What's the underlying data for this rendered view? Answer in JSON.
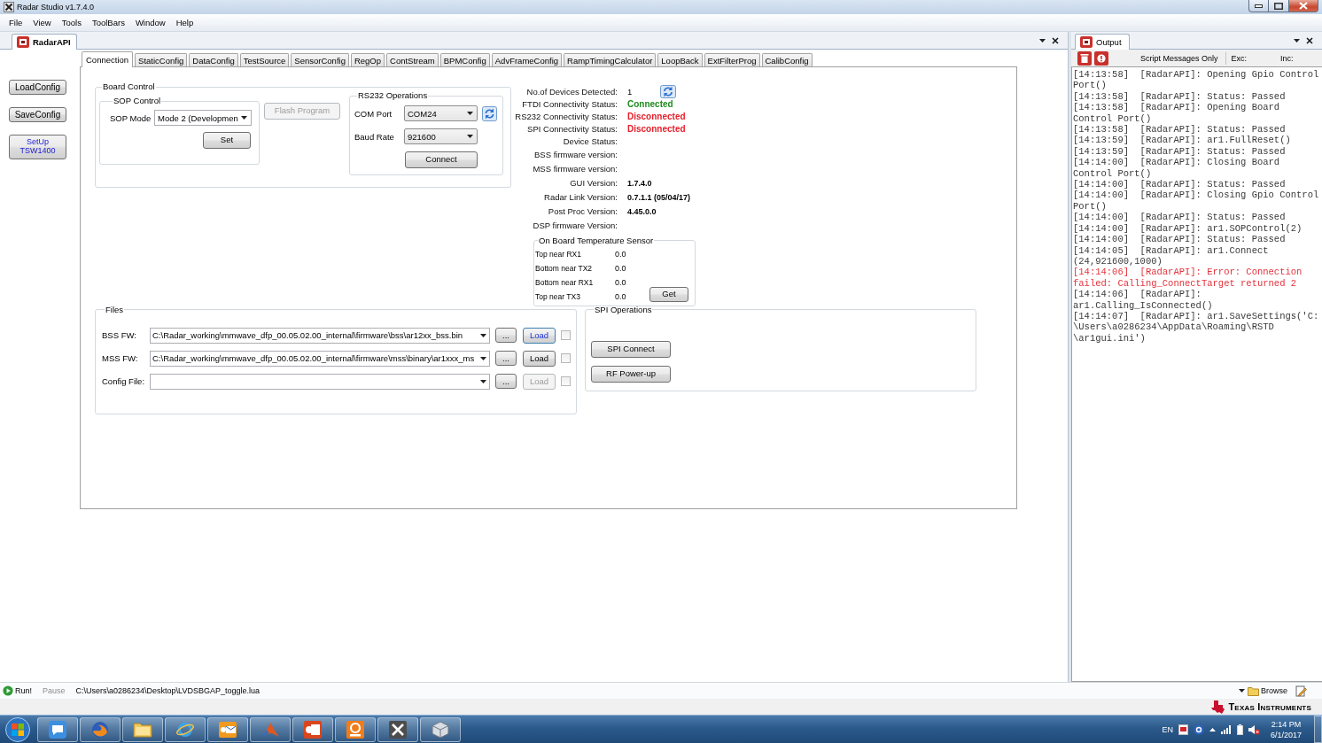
{
  "window": {
    "title": "Radar Studio v1.7.4.0"
  },
  "menu": [
    "File",
    "View",
    "Tools",
    "ToolBars",
    "Window",
    "Help"
  ],
  "document": {
    "tab": "RadarAPI",
    "side_buttons": [
      {
        "lines": [
          "LoadConfig"
        ],
        "kind": "plain"
      },
      {
        "lines": [
          "SaveConfig"
        ],
        "kind": "plain"
      },
      {
        "lines": [
          "SetUp",
          "TSW1400"
        ],
        "kind": "link"
      }
    ],
    "tabs": [
      {
        "label": "Connection",
        "selected": true
      },
      {
        "label": "StaticConfig",
        "selected": false
      },
      {
        "label": "DataConfig",
        "selected": false
      },
      {
        "label": "TestSource",
        "selected": false
      },
      {
        "label": "SensorConfig",
        "selected": false
      },
      {
        "label": "RegOp",
        "selected": false
      },
      {
        "label": "ContStream",
        "selected": false
      },
      {
        "label": "BPMConfig",
        "selected": false
      },
      {
        "label": "AdvFrameConfig",
        "selected": false
      },
      {
        "label": "RampTimingCalculator",
        "selected": false
      },
      {
        "label": "LoopBack",
        "selected": false
      },
      {
        "label": "ExtFilterProg",
        "selected": false
      },
      {
        "label": "CalibConfig",
        "selected": false
      }
    ],
    "board_control": {
      "title": "Board Control",
      "sop_control": {
        "title": "SOP Control",
        "label": "SOP Mode",
        "value": "Mode 2 (Developmen",
        "button": "Set"
      },
      "flash_button": {
        "label": "Flash Program",
        "disabled": true
      },
      "rs232": {
        "title": "RS232 Operations",
        "fields": [
          {
            "label": "COM Port",
            "value": "COM24",
            "refresh": true
          },
          {
            "label": "Baud Rate",
            "value": "921600",
            "refresh": false
          }
        ],
        "button": "Connect"
      }
    },
    "status": [
      {
        "label": "No.of Devices Detected:",
        "value": "1",
        "kind": "count"
      },
      {
        "label": "FTDI Connectivity Status:",
        "value": "Connected",
        "kind": "ok"
      },
      {
        "label": "RS232 Connectivity Status:",
        "value": "Disconnected",
        "kind": "error"
      },
      {
        "label": "SPI Connectivity Status:",
        "value": "Disconnected",
        "kind": "error"
      },
      {
        "label": "Device Status:",
        "kind": "info"
      },
      {
        "label": "BSS firmware version:",
        "kind": "info"
      },
      {
        "label": "MSS firmware version:",
        "kind": "info"
      },
      {
        "label": "GUI Version:",
        "value": "1.7.4.0",
        "kind": "info"
      },
      {
        "label": "Radar Link Version:",
        "value": "0.7.1.1 (05/04/17)",
        "kind": "info"
      },
      {
        "label": "Post Proc Version:",
        "value": "4.45.0.0",
        "kind": "info"
      },
      {
        "label": "DSP firmware Version:",
        "kind": "info"
      }
    ],
    "temperature": {
      "title": "On Board Temperature Sensor",
      "rows": [
        {
          "label": "Top near RX1",
          "value": "0.0"
        },
        {
          "label": "Bottom near TX2",
          "value": "0.0"
        },
        {
          "label": "Bottom near RX1",
          "value": "0.0"
        },
        {
          "label": "Top near TX3",
          "value": "0.0"
        }
      ],
      "button": "Get"
    },
    "files": {
      "title": "Files",
      "rows": [
        {
          "label": "BSS FW:",
          "value": "C:\\Radar_working\\mmwave_dfp_00.05.02.00_internal\\firmware\\bss\\ar12xx_bss.bin",
          "browse": "...",
          "load": {
            "label": "Load",
            "disabled": false,
            "focused": true
          },
          "checked": false
        },
        {
          "label": "MSS FW:",
          "value": "C:\\Radar_working\\mmwave_dfp_00.05.02.00_internal\\firmware\\mss\\binary\\ar1xxx_ms",
          "browse": "...",
          "load": {
            "label": "Load",
            "disabled": false,
            "focused": false
          },
          "checked": false
        },
        {
          "label": "Config File:",
          "browse": "...",
          "load": {
            "label": "Load",
            "disabled": true,
            "focused": false
          },
          "checked": false
        }
      ]
    },
    "spi": {
      "title": "SPI Operations",
      "buttons": [
        "SPI Connect",
        "RF Power-up"
      ]
    }
  },
  "output": {
    "tab": "Output",
    "filter": "Script Messages Only",
    "exc": "Exc:",
    "inc": "Inc:",
    "entries": [
      {
        "kind": "info",
        "lines": [
          "[14:13:58]  [RadarAPI]: Opening Gpio Control",
          "Port()"
        ]
      },
      {
        "kind": "info",
        "lines": [
          "[14:13:58]  [RadarAPI]: Status: Passed"
        ]
      },
      {
        "kind": "info",
        "lines": [
          "[14:13:58]  [RadarAPI]: Opening Board",
          "Control Port()"
        ]
      },
      {
        "kind": "info",
        "lines": [
          "[14:13:58]  [RadarAPI]: Status: Passed"
        ]
      },
      {
        "kind": "info",
        "lines": [
          "[14:13:59]  [RadarAPI]: ar1.FullReset()"
        ]
      },
      {
        "kind": "info",
        "lines": [
          "[14:13:59]  [RadarAPI]: Status: Passed"
        ]
      },
      {
        "kind": "info",
        "lines": [
          "[14:14:00]  [RadarAPI]: Closing Board",
          "Control Port()"
        ]
      },
      {
        "kind": "info",
        "lines": [
          "[14:14:00]  [RadarAPI]: Status: Passed"
        ]
      },
      {
        "kind": "info",
        "lines": [
          "[14:14:00]  [RadarAPI]: Closing Gpio Control",
          "Port()"
        ]
      },
      {
        "kind": "info",
        "lines": [
          "[14:14:00]  [RadarAPI]: Status: Passed"
        ]
      },
      {
        "kind": "info",
        "lines": [
          "[14:14:00]  [RadarAPI]: ar1.SOPControl(2)"
        ]
      },
      {
        "kind": "info",
        "lines": [
          "[14:14:00]  [RadarAPI]: Status: Passed"
        ]
      },
      {
        "kind": "info",
        "lines": [
          "[14:14:05]  [RadarAPI]: ar1.Connect",
          "(24,921600,1000)"
        ]
      },
      {
        "kind": "error",
        "lines": [
          "[14:14:06]  [RadarAPI]: Error: Connection",
          "failed: Calling_ConnectTarget returned 2"
        ]
      },
      {
        "kind": "info",
        "lines": [
          "[14:14:06]  [RadarAPI]:",
          "ar1.Calling_IsConnected()"
        ]
      },
      {
        "kind": "info",
        "lines": [
          "[14:14:07]  [RadarAPI]: ar1.SaveSettings('C:",
          "\\Users\\a0286234\\AppData\\Roaming\\RSTD",
          "\\ar1gui.ini')"
        ]
      }
    ]
  },
  "status_bar": {
    "run": "Run!",
    "pause": {
      "label": "Pause",
      "disabled": true
    },
    "script": "C:\\Users\\a0286234\\Desktop\\LVDSBGAP_toggle.lua",
    "browse": "Browse"
  },
  "brand": "Texas Instruments",
  "taskbar": {
    "language": "EN",
    "time": "2:14 PM",
    "date": "6/1/2017"
  }
}
